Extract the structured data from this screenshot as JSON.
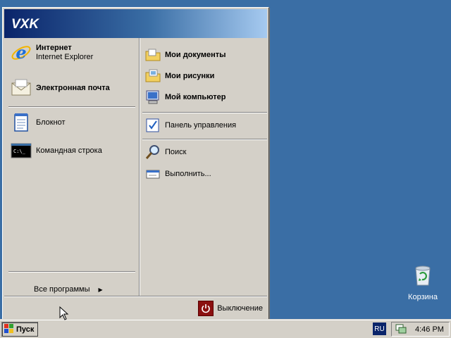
{
  "start_menu": {
    "username": "VXK",
    "pinned": [
      {
        "title": "Интернет",
        "subtitle": "Internet Explorer",
        "icon": "internet-explorer-icon"
      },
      {
        "title": "Электронная почта",
        "icon": "mail-icon"
      }
    ],
    "recent": [
      {
        "label": "Блокнот",
        "icon": "notepad-icon"
      },
      {
        "label": "Командная строка",
        "icon": "command-prompt-icon"
      }
    ],
    "all_programs_label": "Все программы",
    "places": [
      {
        "label": "Мои документы",
        "icon": "folder-documents-icon"
      },
      {
        "label": "Мои рисунки",
        "icon": "folder-pictures-icon"
      },
      {
        "label": "Мой компьютер",
        "icon": "computer-icon"
      }
    ],
    "control_panel_label": "Панель управления",
    "search_label": "Поиск",
    "run_label": "Выполнить...",
    "shutdown_label": "Выключение"
  },
  "desktop": {
    "recycle_bin_label": "Корзина"
  },
  "taskbar": {
    "start_label": "Пуск",
    "language": "RU",
    "clock": "4:46 PM"
  },
  "colors": {
    "desktop": "#3a6ea5",
    "menu_face": "#d4d0c8",
    "header_start": "#0a246a",
    "header_end": "#a6caf0"
  }
}
